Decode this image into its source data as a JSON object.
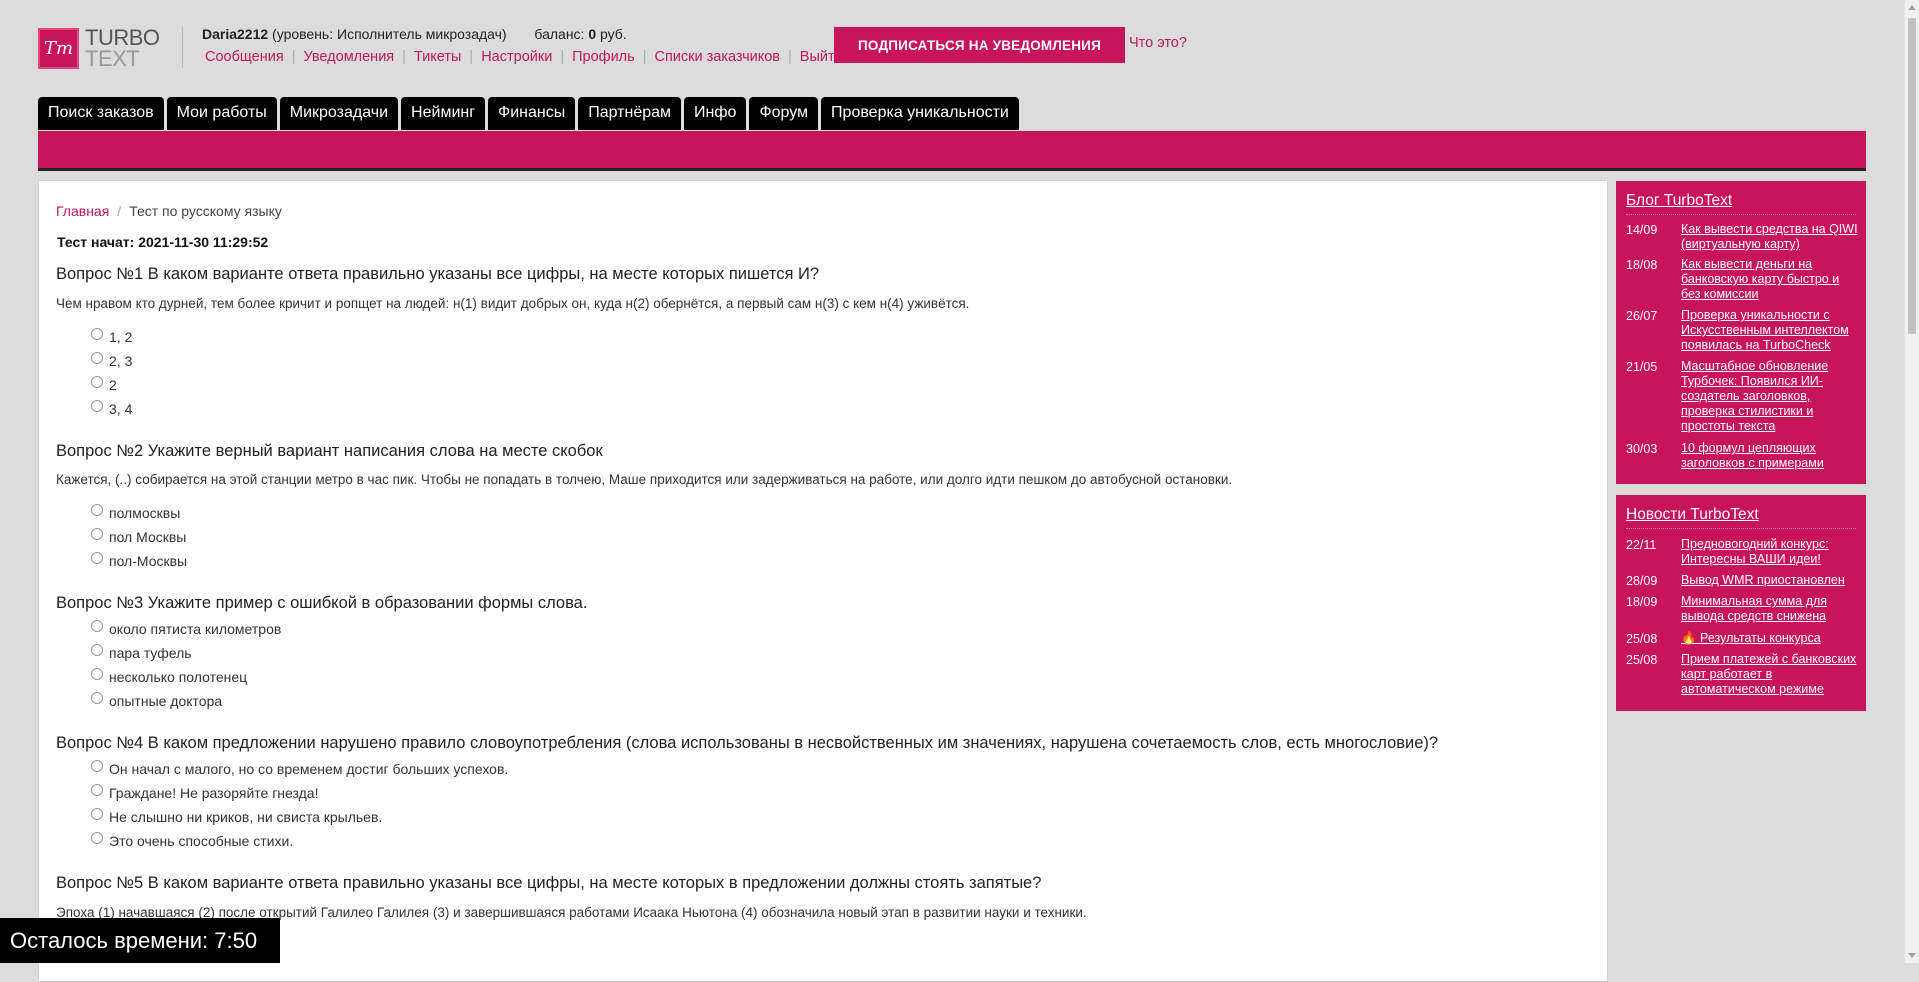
{
  "header": {
    "logo_badge": "Tт",
    "logo_line1": "TURBO",
    "logo_line2": "TEXT",
    "username": "Daria2212",
    "level_prefix": " (уровень: ",
    "level": "Исполнитель микрозадач",
    "level_suffix": ")",
    "balance_label": "баланс: ",
    "balance_value": "0",
    "balance_currency": " руб.",
    "links": [
      "Сообщения",
      "Уведомления",
      "Тикеты",
      "Настройки",
      "Профиль",
      "Списки заказчиков",
      "Выйти"
    ],
    "subscribe_button": "ПОДПИСАТЬСЯ НА УВЕДОМЛЕНИЯ",
    "what_link": "Что это?"
  },
  "nav": {
    "tabs": [
      "Поиск заказов",
      "Мои работы",
      "Микрозадачи",
      "Нейминг",
      "Финансы",
      "Партнёрам",
      "Инфо",
      "Форум",
      "Проверка уникальности"
    ]
  },
  "breadcrumb": {
    "home": "Главная",
    "current": "Тест по русскому языку"
  },
  "test_started": "Тест начат: 2021-11-30 11:29:52",
  "questions": [
    {
      "title": "Вопрос №1 В каком варианте ответа правильно указаны все цифры, на месте которых пишется И?",
      "text": "Чем нравом кто дурней, тем более кричит и ропщет на людей: н(1) видит добрых он, куда н(2) обернётся, а первый сам н(3) с кем н(4) уживётся.",
      "options": [
        "1, 2",
        "2, 3",
        "2",
        "3, 4"
      ]
    },
    {
      "title": "Вопрос №2 Укажите верный вариант написания слова на месте скобок",
      "text": "Кажется, (..) собирается на этой станции метро в час пик. Чтобы не попадать в толчею, Маше приходится или задерживаться на работе, или долго идти пешком до автобусной остановки.",
      "options": [
        "полмосквы",
        "пол Москвы",
        "пол-Москвы"
      ]
    },
    {
      "title": "Вопрос №3 Укажите пример с ошибкой в образовании формы слова.",
      "options": [
        "около пятиста километров",
        "пара туфель",
        "несколько полотенец",
        "опытные доктора"
      ]
    },
    {
      "title": "Вопрос №4 В каком предложении нарушено правило словоупотребления (слова использованы в несвойственных им значениях, нарушена сочетаемость слов, есть многословие)?",
      "options": [
        "Он начал с малого, но со временем достиг больших успехов.",
        "Граждане! Не разоряйте гнезда!",
        "Не слышно ни криков, ни свиста крыльев.",
        "Это очень способные стихи."
      ]
    },
    {
      "title": "Вопрос №5 В каком варианте ответа правильно указаны все цифры, на месте которых в предложении должны стоять запятые?",
      "text": "Эпоха (1) начавшаяся (2) после открытий Галилео Галилея (3) и завершившаяся работами Исаака Ньютона (4) обозначила новый этап в развитии науки и техники."
    }
  ],
  "sidebar": {
    "blog": {
      "title": "Блог TurboText",
      "items": [
        {
          "date": "14/09",
          "text": "Как вывести средства на QIWI (виртуальную карту)"
        },
        {
          "date": "18/08",
          "text": "Как вывести деньги на банковскую карту быстро и без комиссии"
        },
        {
          "date": "26/07",
          "text": "Проверка уникальности с Искусственным интеллектом появилась на TurboCheck"
        },
        {
          "date": "21/05",
          "text": "Масштабное обновление Турбочек: Появился ИИ-создатель заголовков, проверка стилистики и простоты текста"
        },
        {
          "date": "30/03",
          "text": "10 формул цепляющих заголовков с примерами"
        }
      ]
    },
    "news": {
      "title": "Новости TurboText",
      "items": [
        {
          "date": "22/11",
          "text": "Предновогодний конкурс: Интересны ВАШИ идеи!"
        },
        {
          "date": "28/09",
          "text": "Вывод WMR приостановлен"
        },
        {
          "date": "18/09",
          "text": "Минимальная сумма для вывода средств снижена"
        },
        {
          "date": "25/08",
          "text": "🔥 Результаты конкурса"
        },
        {
          "date": "25/08",
          "text": "Прием платежей с банковских карт работает в автоматическом режиме"
        }
      ]
    }
  },
  "timer": "Осталось времени: 7:50"
}
